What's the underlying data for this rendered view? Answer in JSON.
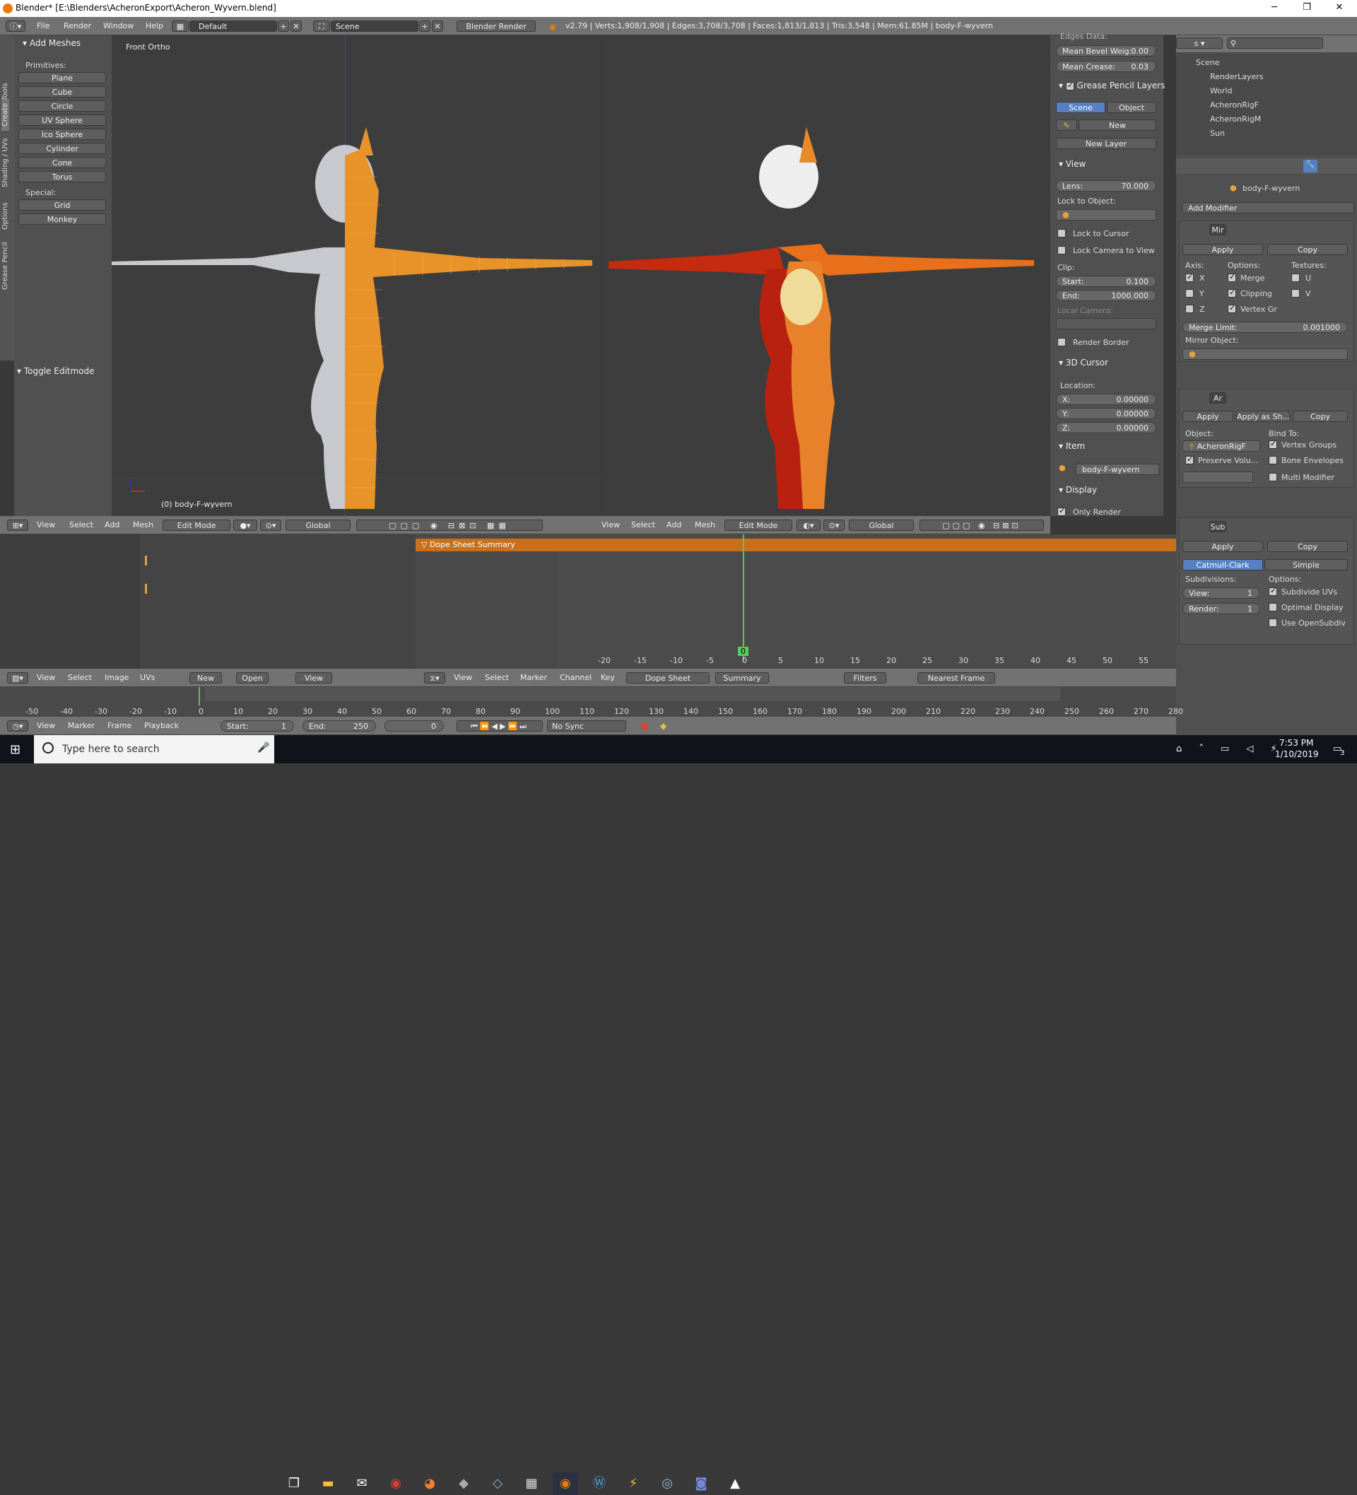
{
  "window": {
    "title": "Blender* [E:\\Blenders\\AcheronExport\\Acheron_Wyvern.blend]"
  },
  "topbar": {
    "menus": [
      "File",
      "Render",
      "Window",
      "Help"
    ],
    "layout": "Default",
    "scene": "Scene",
    "engine": "Blender Render",
    "stats": "v2.79 | Verts:1,908/1,908 | Edges:3,708/3,708 | Faces:1,813/1,813 | Tris:3,548 | Mem:61.85M | body-F-wyvern"
  },
  "toolshelf": {
    "tabs": [
      "Tools",
      "Create",
      "Shading / UVs",
      "Options",
      "Grease Pencil"
    ],
    "section": "Add Meshes",
    "primitives_label": "Primitives:",
    "primitives": [
      "Plane",
      "Cube",
      "Circle",
      "UV Sphere",
      "Ico Sphere",
      "Cylinder",
      "Cone",
      "Torus"
    ],
    "special_label": "Special:",
    "special": [
      "Grid",
      "Monkey"
    ],
    "toggle": "Toggle Editmode"
  },
  "viewport_left": {
    "label": "Front Ortho",
    "object": "(0) body-F-wyvern"
  },
  "vp_header_left": {
    "items": [
      "View",
      "Select",
      "Add",
      "Mesh"
    ],
    "mode": "Edit Mode",
    "orientation": "Global"
  },
  "vp_header_right": {
    "items": [
      "View",
      "Select",
      "Add",
      "Mesh"
    ],
    "mode": "Edit Mode",
    "orientation": "Global"
  },
  "properties_n": {
    "edges_data": "Edges Data:",
    "mean_bevel": {
      "label": "Mean Bevel Weig:",
      "value": "0.00"
    },
    "mean_crease": {
      "label": "Mean Crease:",
      "value": "0.03"
    },
    "grease_title": "Grease Pencil Layers",
    "scene_btn": "Scene",
    "object_btn": "Object",
    "new_btn": "New",
    "new_layer": "New Layer",
    "view_title": "View",
    "lens": {
      "label": "Lens:",
      "value": "70.000"
    },
    "lock_obj": "Lock to Object:",
    "lock_cursor": "Lock to Cursor",
    "lock_camera": "Lock Camera to View",
    "clip": "Clip:",
    "clip_start": {
      "label": "Start:",
      "value": "0.100"
    },
    "clip_end": {
      "label": "End:",
      "value": "1000.000"
    },
    "local_camera": "Local Camera:",
    "render_border": "Render Border",
    "cursor_title": "3D Cursor",
    "location": "Location:",
    "cx": {
      "label": "X:",
      "value": "0.00000"
    },
    "cy": {
      "label": "Y:",
      "value": "0.00000"
    },
    "cz": {
      "label": "Z:",
      "value": "0.00000"
    },
    "item_title": "Item",
    "item_name": "body-F-wyvern",
    "display_title": "Display",
    "only_render": "Only Render"
  },
  "outliner": {
    "items": [
      "Scene",
      "RenderLayers",
      "World",
      "AcheronRigF",
      "AcheronRigM",
      "Sun"
    ]
  },
  "properties": {
    "object": "body-F-wyvern",
    "add_modifier": "Add Modifier",
    "mirror": {
      "name": "Mir",
      "apply": "Apply",
      "copy": "Copy",
      "axis": "Axis:",
      "options": "Options:",
      "textures": "Textures:",
      "x": "X",
      "y": "Y",
      "z": "Z",
      "merge": "Merge",
      "clipping": "Clipping",
      "vertex": "Vertex Gr",
      "u": "U",
      "v": "V",
      "merge_limit": {
        "label": "Merge Limit:",
        "value": "0.001000"
      },
      "mirror_object": "Mirror Object:"
    },
    "armature": {
      "name": "Ar",
      "apply": "Apply",
      "apply_as": "Apply as Sh...",
      "copy": "Copy",
      "object": "Object:",
      "bind_to": "Bind To:",
      "obj_val": "AcheronRigF",
      "vertex_groups": "Vertex Groups",
      "preserve": "Preserve Volu...",
      "bone_env": "Bone Envelopes",
      "multi": "Multi Modifier"
    },
    "subsurf": {
      "name": "Sub",
      "apply": "Apply",
      "copy": "Copy",
      "catmull": "Catmull-Clark",
      "simple": "Simple",
      "subdivisions": "Subdivisions:",
      "options": "Options:",
      "view": {
        "label": "View:",
        "value": "1"
      },
      "render": {
        "label": "Render:",
        "value": "1"
      },
      "sub_uvs": "Subdivide UVs",
      "optimal": "Optimal Display",
      "opensubdiv": "Use OpenSubdiv"
    }
  },
  "uv_header": {
    "items": [
      "View",
      "Select",
      "Image",
      "UVs"
    ],
    "new": "New",
    "open": "Open",
    "view": "View"
  },
  "dopesheet": {
    "summary": "Dope Sheet Summary",
    "frame": "0",
    "ticks": [
      "-20",
      "-15",
      "-10",
      "-5",
      "0",
      "5",
      "10",
      "15",
      "20",
      "25",
      "30",
      "35",
      "40",
      "45",
      "50",
      "55"
    ],
    "header_items": [
      "View",
      "Select",
      "Marker",
      "Channel",
      "Key"
    ],
    "mode": "Dope Sheet",
    "summary_btn": "Summary",
    "filters": "Filters",
    "snap": "Nearest Frame"
  },
  "timeline": {
    "ticks": [
      "-50",
      "-40",
      "-30",
      "-20",
      "-10",
      "0",
      "10",
      "20",
      "30",
      "40",
      "50",
      "60",
      "70",
      "80",
      "90",
      "100",
      "110",
      "120",
      "130",
      "140",
      "150",
      "160",
      "170",
      "180",
      "190",
      "200",
      "210",
      "220",
      "230",
      "240",
      "250",
      "260",
      "270",
      "280"
    ],
    "items": [
      "View",
      "Marker",
      "Frame",
      "Playback"
    ],
    "start": {
      "label": "Start:",
      "value": "1"
    },
    "end": {
      "label": "End:",
      "value": "250"
    },
    "current": "0",
    "sync": "No Sync"
  },
  "taskbar": {
    "search": "Type here to search",
    "time": "7:53 PM",
    "date": "1/10/2019",
    "notif": "3"
  }
}
